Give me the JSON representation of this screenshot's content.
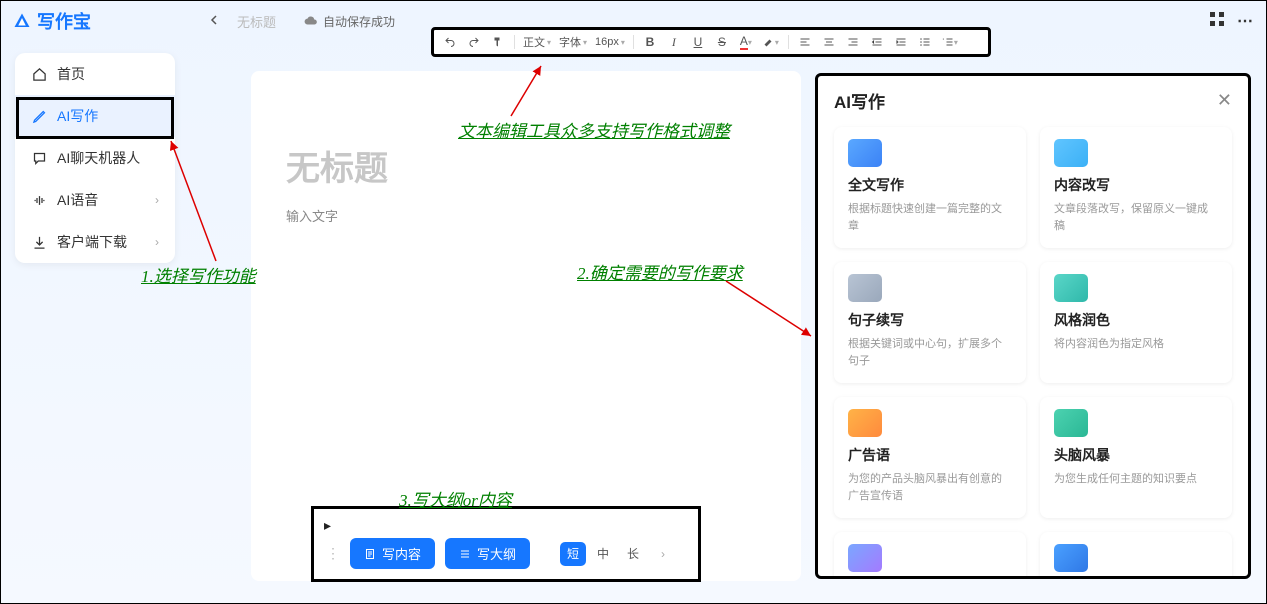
{
  "app": {
    "name": "写作宝"
  },
  "header": {
    "doc_name": "无标题",
    "autosave_label": "自动保存成功"
  },
  "sidebar": {
    "items": [
      {
        "label": "首页",
        "icon": "home-icon"
      },
      {
        "label": "AI写作",
        "icon": "pencil-icon",
        "active": true
      },
      {
        "label": "AI聊天机器人",
        "icon": "chat-icon"
      },
      {
        "label": "AI语音",
        "icon": "audio-icon",
        "expandable": true
      },
      {
        "label": "客户端下载",
        "icon": "download-icon",
        "expandable": true
      }
    ]
  },
  "toolbar": {
    "paragraph_label": "正文",
    "font_label": "字体",
    "size_label": "16px"
  },
  "editor": {
    "title_placeholder": "无标题",
    "body_placeholder": "输入文字"
  },
  "bottom": {
    "write_content_label": "写内容",
    "write_outline_label": "写大纲",
    "length_options": [
      "短",
      "中",
      "长"
    ],
    "length_selected": "短"
  },
  "ai_panel": {
    "title": "AI写作",
    "cards": [
      {
        "title": "全文写作",
        "desc": "根据标题快速创建一篇完整的文章",
        "icon": "ico-blue"
      },
      {
        "title": "内容改写",
        "desc": "文章段落改写，保留原义一键成稿",
        "icon": "ico-cyan"
      },
      {
        "title": "句子续写",
        "desc": "根据关键词或中心句，扩展多个句子",
        "icon": "ico-gray"
      },
      {
        "title": "风格润色",
        "desc": "将内容润色为指定风格",
        "icon": "ico-teal"
      },
      {
        "title": "广告语",
        "desc": "为您的产品头脑风暴出有创意的广告宣传语",
        "icon": "ico-orange"
      },
      {
        "title": "头脑风暴",
        "desc": "为您生成任何主题的知识要点",
        "icon": "ico-green"
      },
      {
        "title": "",
        "desc": "",
        "icon": "ico-mix1"
      },
      {
        "title": "",
        "desc": "",
        "icon": "ico-mix2"
      }
    ]
  },
  "annotations": {
    "a1": "1.选择写作功能",
    "a2": "2.确定需要的写作要求",
    "a3": "3.写大纲or内容",
    "toolbar_note": "文本编辑工具众多支持写作格式调整"
  }
}
